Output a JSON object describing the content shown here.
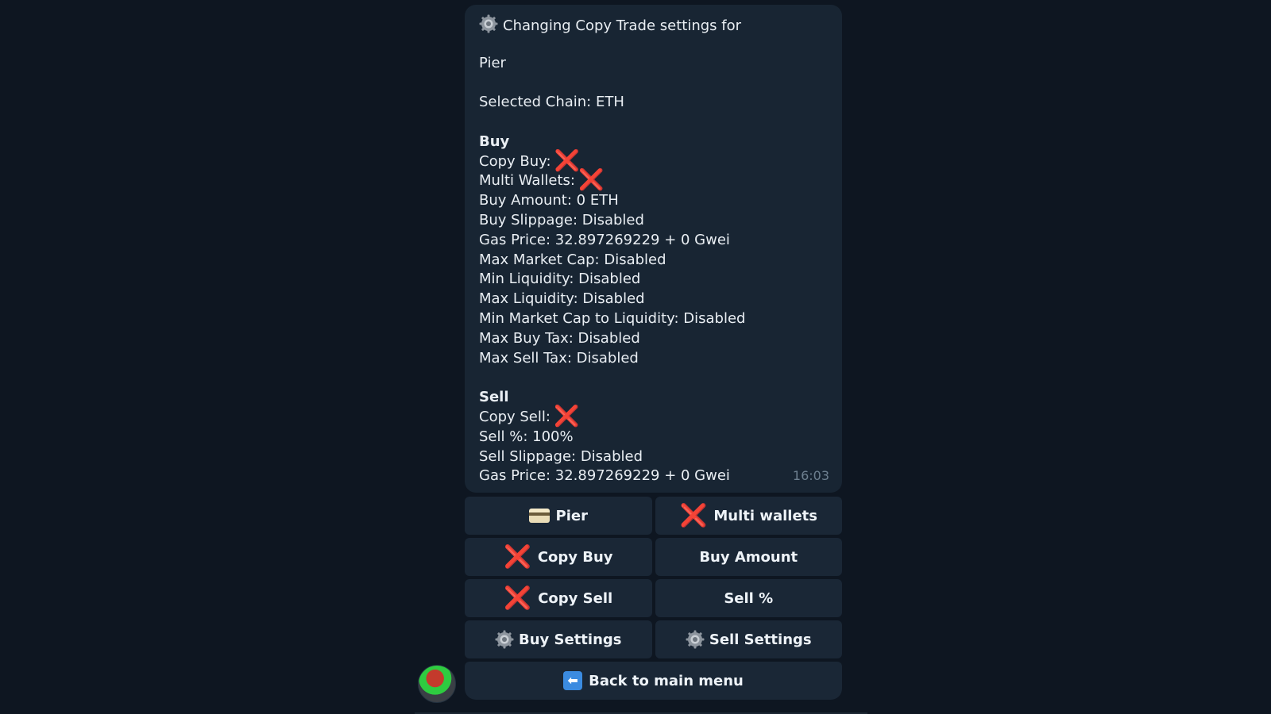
{
  "message": {
    "header": "Changing Copy Trade settings for",
    "wallet_name": "Pier",
    "selected_chain": "Selected Chain: ETH",
    "buy_section": {
      "title": "Buy",
      "copy_buy_label": "Copy Buy:",
      "multi_wallets_label": "Multi Wallets:",
      "lines": [
        "Buy Amount: 0 ETH",
        "Buy Slippage: Disabled",
        "Gas Price: 32.897269229 + 0 Gwei",
        "Max Market Cap: Disabled",
        "Min Liquidity: Disabled",
        "Max Liquidity: Disabled",
        "Min Market Cap to Liquidity: Disabled",
        "Max Buy Tax: Disabled",
        "Max Sell Tax: Disabled"
      ]
    },
    "sell_section": {
      "title": "Sell",
      "copy_sell_label": "Copy Sell:",
      "lines": [
        "Sell %: 100%",
        "Sell Slippage: Disabled",
        "Gas Price: 32.897269229 + 0 Gwei"
      ]
    },
    "time": "16:03",
    "cross_mark": "❌",
    "gear_icon": "gear-icon"
  },
  "keyboard": {
    "pier": "Pier",
    "multi_wallets": "Multi wallets",
    "copy_buy": "Copy Buy",
    "buy_amount": "Buy Amount",
    "copy_sell": "Copy Sell",
    "sell_percent": "Sell %",
    "buy_settings": "Buy Settings",
    "sell_settings": "Sell Settings",
    "back": "Back to main menu"
  },
  "colors": {
    "background": "#0e1621",
    "bubble": "#182533",
    "button": "#1a2736",
    "cross": "#e0242b"
  }
}
